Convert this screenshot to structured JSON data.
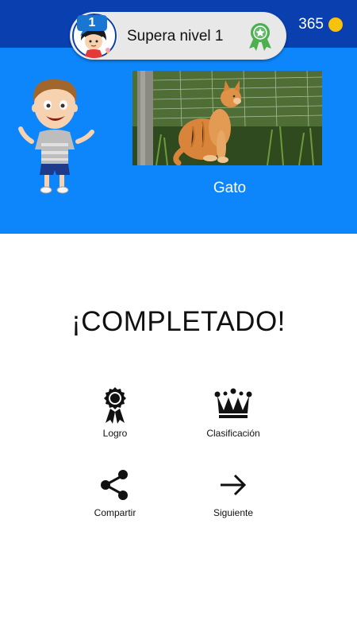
{
  "header": {
    "level_number": "1",
    "level_title": "Supera nivel 1",
    "coins": "365",
    "icons": [
      "girl-avatar",
      "award-ribbon-icon",
      "coin-icon"
    ]
  },
  "word_card": {
    "caption": "Gato",
    "image": "orange cat sitting in grass"
  },
  "result": {
    "title": "¡COMPLETADO!"
  },
  "actions": [
    {
      "label": "Logro",
      "icon": "medal-icon"
    },
    {
      "label": "Clasificación",
      "icon": "crown-icon"
    },
    {
      "label": "Compartir",
      "icon": "share-icon"
    },
    {
      "label": "Siguiente",
      "icon": "arrow-right-icon"
    }
  ],
  "colors": {
    "top_bar": "#0a3fb0",
    "panel": "#0d86fb",
    "coin": "#f6c20c",
    "award": "#4caf50"
  }
}
